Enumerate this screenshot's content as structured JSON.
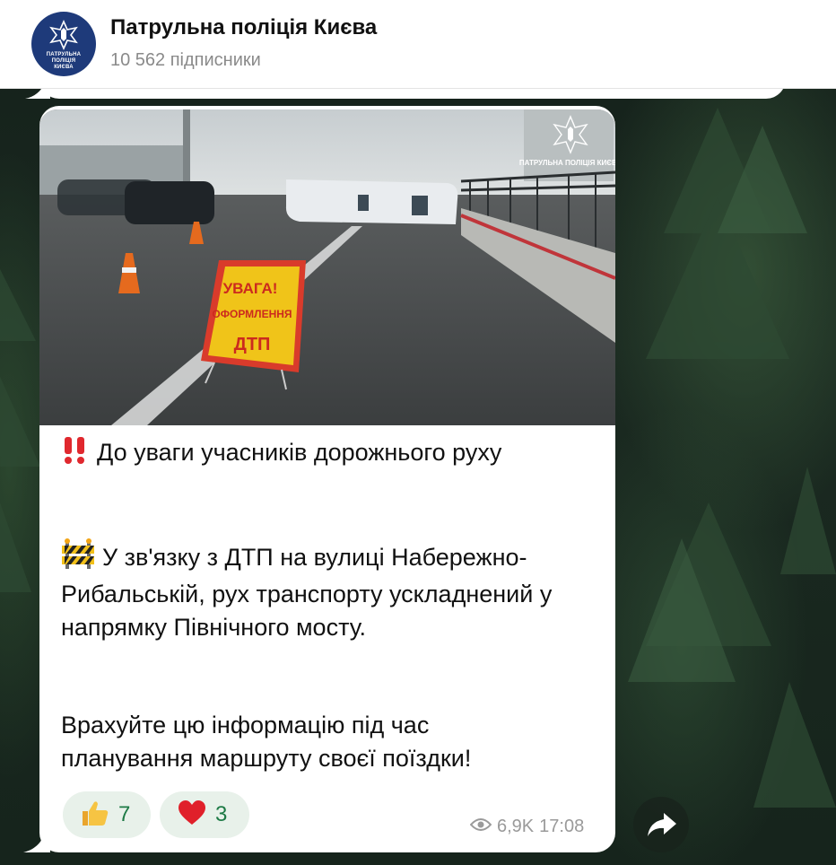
{
  "channel": {
    "title": "Патрульна поліція Києва",
    "subscribers": "10 562 підписники",
    "avatar_text": [
      "ПАТРУЛЬНА",
      "ПОЛІЦІЯ",
      "КИЄВА"
    ]
  },
  "photo": {
    "watermark": "ПАТРУЛЬНА ПОЛІЦІЯ КИЄВА",
    "sign_lines": [
      "УВАГА!",
      "ОФОРМЛЕННЯ",
      "ДТП"
    ]
  },
  "message": {
    "line1_icon": "double-exclamation-icon",
    "line1": "До уваги учасників дорожнього руху",
    "line2_icon": "construction-barrier-icon",
    "line2": "У зв'язку з ДТП на вулиці Набережно-Рибальській, рух транспорту ускладнений у напрямку Північного мосту.",
    "line3": "Врахуйте цю інформацію під час планування маршруту своєї поїздки!"
  },
  "reactions": [
    {
      "icon": "thumbs-up-icon",
      "count": "7"
    },
    {
      "icon": "heart-icon",
      "count": "3"
    }
  ],
  "meta": {
    "views": "6,9K",
    "time": "17:08"
  },
  "colors": {
    "reaction_bg": "#e8f1ea",
    "reaction_text": "#1d7a45",
    "meta_text": "#9a9a9a",
    "header_bg": "#ffffff"
  }
}
